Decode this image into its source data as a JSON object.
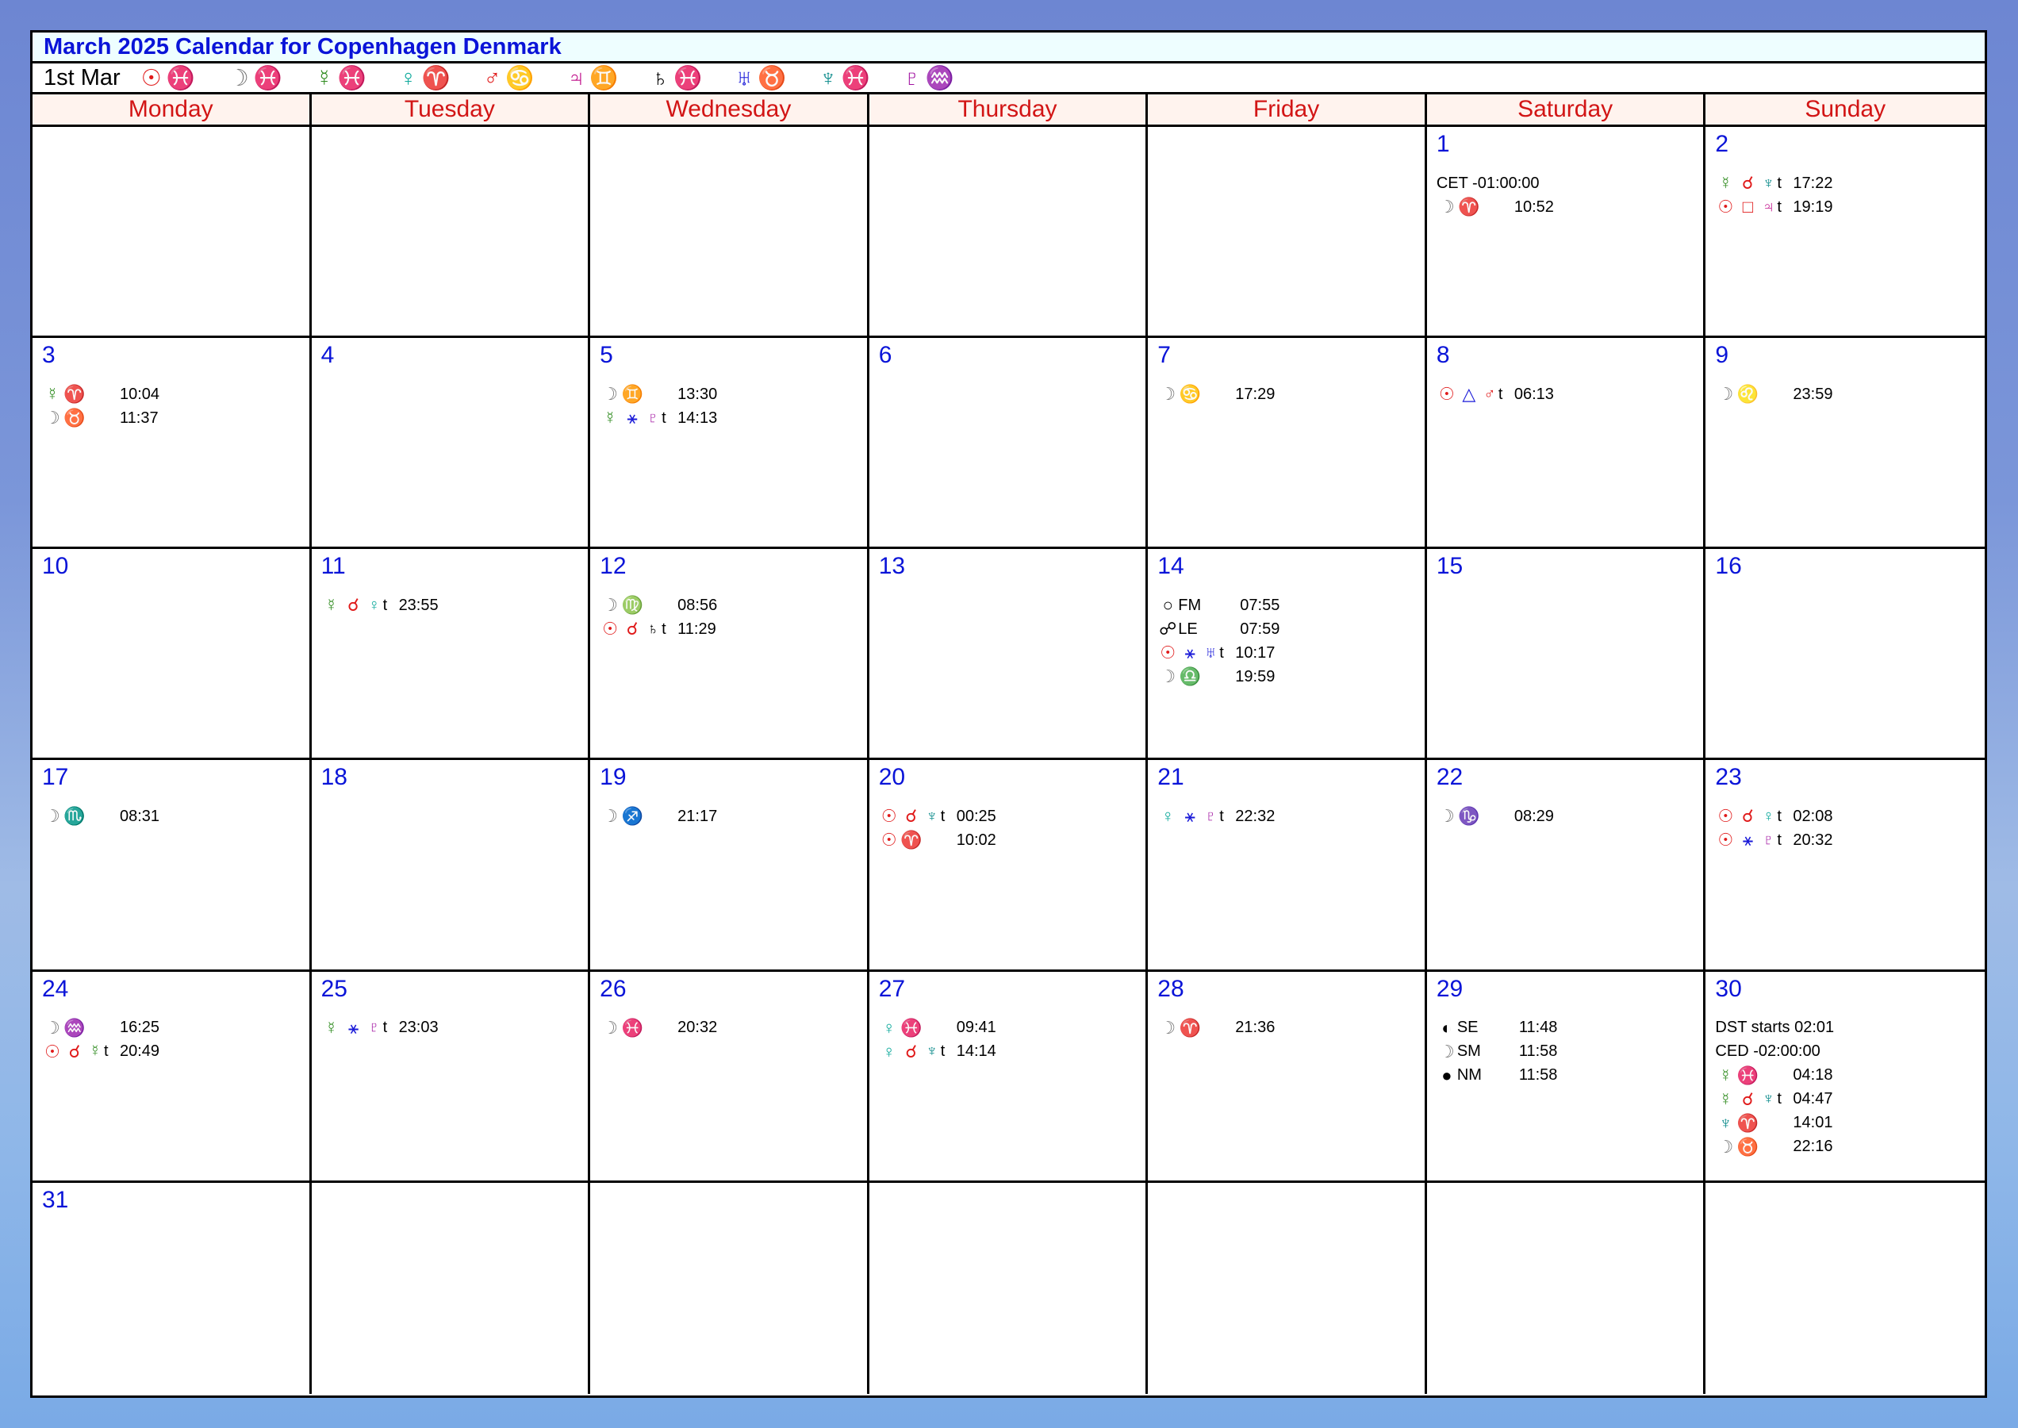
{
  "title": "March 2025 Calendar for Copenhagen Denmark",
  "planet_bar": {
    "date": "1st Mar",
    "positions": [
      {
        "glyphs": "☉♓",
        "color": "#e01a1a"
      },
      {
        "glyphs": "☽♓",
        "color": "#777777"
      },
      {
        "glyphs": "☿♓",
        "color": "#2c8a1c"
      },
      {
        "glyphs": "♀♈",
        "color": "#0aa89a"
      },
      {
        "glyphs": "♂♋",
        "color": "#e01a1a"
      },
      {
        "glyphs": "♃♊",
        "color": "#c0108a"
      },
      {
        "glyphs": "♄♓",
        "color": "#000000"
      },
      {
        "glyphs": "♅♉",
        "color": "#1a1ad8"
      },
      {
        "glyphs": "♆♓",
        "color": "#0a8a8a"
      },
      {
        "glyphs": "♇♒",
        "color": "#a010a0"
      }
    ]
  },
  "weekdays": [
    "Monday",
    "Tuesday",
    "Wednesday",
    "Thursday",
    "Friday",
    "Saturday",
    "Sunday"
  ],
  "weeks": [
    [
      {
        "day": "",
        "events": []
      },
      {
        "day": "",
        "events": []
      },
      {
        "day": "",
        "events": []
      },
      {
        "day": "",
        "events": []
      },
      {
        "day": "",
        "events": []
      },
      {
        "day": "1",
        "events": [
          {
            "full": "CET -01:00:00"
          },
          {
            "g1": "☽",
            "g2": "♈",
            "time": "10:52"
          }
        ]
      },
      {
        "day": "2",
        "events": [
          {
            "g1": "☿",
            "g2": "☌",
            "g3": "♆",
            "t": "t",
            "time": "17:22"
          },
          {
            "g1": "☉",
            "g2": "□",
            "g3": "♃",
            "t": "t",
            "time": "19:19"
          }
        ]
      }
    ],
    [
      {
        "day": "3",
        "events": [
          {
            "g1": "☿",
            "g2": "♈",
            "time": "10:04"
          },
          {
            "g1": "☽",
            "g2": "♉",
            "time": "11:37"
          }
        ]
      },
      {
        "day": "4",
        "events": []
      },
      {
        "day": "5",
        "events": [
          {
            "g1": "☽",
            "g2": "♊",
            "time": "13:30"
          },
          {
            "g1": "☿",
            "g2": "⚹",
            "g3": "♇",
            "t": "t",
            "time": "14:13"
          }
        ]
      },
      {
        "day": "6",
        "events": []
      },
      {
        "day": "7",
        "events": [
          {
            "g1": "☽",
            "g2": "♋",
            "time": "17:29"
          }
        ]
      },
      {
        "day": "8",
        "events": [
          {
            "g1": "☉",
            "g2": "△",
            "g3": "♂",
            "t": "t",
            "time": "06:13"
          }
        ]
      },
      {
        "day": "9",
        "events": [
          {
            "g1": "☽",
            "g2": "♌",
            "time": "23:59"
          }
        ]
      }
    ],
    [
      {
        "day": "10",
        "events": []
      },
      {
        "day": "11",
        "events": [
          {
            "g1": "☿",
            "g2": "☌",
            "g3": "♀",
            "t": "t",
            "time": "23:55"
          }
        ]
      },
      {
        "day": "12",
        "events": [
          {
            "g1": "☽",
            "g2": "♍",
            "time": "08:56"
          },
          {
            "g1": "☉",
            "g2": "☌",
            "g3": "♄",
            "t": "t",
            "time": "11:29"
          }
        ]
      },
      {
        "day": "13",
        "events": []
      },
      {
        "day": "14",
        "events": [
          {
            "g1": "○",
            "label": "FM",
            "time": "07:55"
          },
          {
            "g1": "☍",
            "label": "LE",
            "time": "07:59"
          },
          {
            "g1": "☉",
            "g2": "⚹",
            "g3": "♅",
            "t": "t",
            "time": "10:17"
          },
          {
            "g1": "☽",
            "g2": "♎",
            "time": "19:59"
          }
        ]
      },
      {
        "day": "15",
        "events": []
      },
      {
        "day": "16",
        "events": []
      }
    ],
    [
      {
        "day": "17",
        "events": [
          {
            "g1": "☽",
            "g2": "♏",
            "time": "08:31"
          }
        ]
      },
      {
        "day": "18",
        "events": []
      },
      {
        "day": "19",
        "events": [
          {
            "g1": "☽",
            "g2": "♐",
            "time": "21:17"
          }
        ]
      },
      {
        "day": "20",
        "events": [
          {
            "g1": "☉",
            "g2": "☌",
            "g3": "♆",
            "t": "t",
            "time": "00:25"
          },
          {
            "g1": "☉",
            "g2": "♈",
            "time": "10:02"
          }
        ]
      },
      {
        "day": "21",
        "events": [
          {
            "g1": "♀",
            "g2": "⚹",
            "g3": "♇",
            "t": "t",
            "time": "22:32"
          }
        ]
      },
      {
        "day": "22",
        "events": [
          {
            "g1": "☽",
            "g2": "♑",
            "time": "08:29"
          }
        ]
      },
      {
        "day": "23",
        "events": [
          {
            "g1": "☉",
            "g2": "☌",
            "g3": "♀",
            "t": "t",
            "time": "02:08"
          },
          {
            "g1": "☉",
            "g2": "⚹",
            "g3": "♇",
            "t": "t",
            "time": "20:32"
          }
        ]
      }
    ],
    [
      {
        "day": "24",
        "events": [
          {
            "g1": "☽",
            "g2": "♒",
            "time": "16:25"
          },
          {
            "g1": "☉",
            "g2": "☌",
            "g3": "☿",
            "t": "t",
            "time": "20:49"
          }
        ]
      },
      {
        "day": "25",
        "events": [
          {
            "g1": "☿",
            "g2": "⚹",
            "g3": "♇",
            "t": "t",
            "time": "23:03"
          }
        ]
      },
      {
        "day": "26",
        "events": [
          {
            "g1": "☽",
            "g2": "♓",
            "time": "20:32"
          }
        ]
      },
      {
        "day": "27",
        "events": [
          {
            "g1": "♀",
            "g2": "♓",
            "time": "09:41"
          },
          {
            "g1": "♀",
            "g2": "☌",
            "g3": "♆",
            "t": "t",
            "time": "14:14"
          }
        ]
      },
      {
        "day": "28",
        "events": [
          {
            "g1": "☽",
            "g2": "♈",
            "time": "21:36"
          }
        ]
      },
      {
        "day": "29",
        "events": [
          {
            "g1": "◐",
            "label": "SE",
            "time": "11:48"
          },
          {
            "g1": "☽",
            "label": "SM",
            "time": "11:58"
          },
          {
            "g1": "●",
            "label": "NM",
            "time": "11:58"
          }
        ]
      },
      {
        "day": "30",
        "events": [
          {
            "full": "DST starts  02:01"
          },
          {
            "full": "CED -02:00:00"
          },
          {
            "g1": "☿",
            "g2": "♓",
            "time": "04:18"
          },
          {
            "g1": "☿",
            "g2": "☌",
            "g3": "♆",
            "t": "t",
            "time": "04:47"
          },
          {
            "g1": "♆",
            "g2": "♈",
            "time": "14:01"
          },
          {
            "g1": "☽",
            "g2": "♉",
            "time": "22:16"
          }
        ]
      }
    ],
    [
      {
        "day": "31",
        "events": []
      },
      {
        "day": "",
        "events": []
      },
      {
        "day": "",
        "events": []
      },
      {
        "day": "",
        "events": []
      },
      {
        "day": "",
        "events": []
      },
      {
        "day": "",
        "events": []
      },
      {
        "day": "",
        "events": []
      }
    ]
  ],
  "glyph_colors": {
    "☉": "#e01a1a",
    "☽": "#777777",
    "☿": "#2c8a1c",
    "♀": "#0aa89a",
    "♂": "#e01a1a",
    "♃": "#c0108a",
    "♄": "#000000",
    "♅": "#1a1ad8",
    "♆": "#0a8a8a",
    "♇": "#a010a0",
    "♈": "#e01a1a",
    "♉": "#2c8a1c",
    "♊": "#1a1ad8",
    "♋": "#c0108a",
    "♌": "#e01a1a",
    "♍": "#2c8a1c",
    "♎": "#1a1ad8",
    "♏": "#c0108a",
    "♐": "#e01a1a",
    "♑": "#2c8a1c",
    "♒": "#1a1ad8",
    "♓": "#c0108a",
    "☌": "#e01a1a",
    "□": "#e01a1a",
    "△": "#1a1ad8",
    "⚹": "#1a1ad8",
    "○": "#000000",
    "●": "#000000",
    "◐": "#000000",
    "☍": "#000000"
  }
}
